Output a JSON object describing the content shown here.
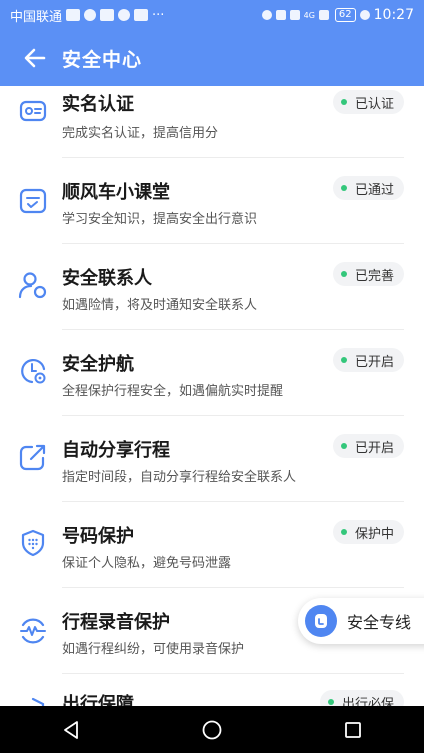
{
  "status_bar": {
    "carrier": "中国联通",
    "more": "···",
    "signal": "4G",
    "battery": "62",
    "time": "10:27"
  },
  "header": {
    "title": "安全中心"
  },
  "items": [
    {
      "title": "实名认证",
      "desc": "完成实名认证，提高信用分",
      "status": "已认证",
      "icon": "id-card-icon"
    },
    {
      "title": "顺风车小课堂",
      "desc": "学习安全知识，提高安全出行意识",
      "status": "已通过",
      "icon": "classroom-icon"
    },
    {
      "title": "安全联系人",
      "desc": "如遇险情，将及时通知安全联系人",
      "status": "已完善",
      "icon": "contact-icon"
    },
    {
      "title": "安全护航",
      "desc": "全程保护行程安全，如遇偏航实时提醒",
      "status": "已开启",
      "icon": "escort-icon"
    },
    {
      "title": "自动分享行程",
      "desc": "指定时间段，自动分享行程给安全联系人",
      "status": "已开启",
      "icon": "share-icon"
    },
    {
      "title": "号码保护",
      "desc": "保证个人隐私，避免号码泄露",
      "status": "保护中",
      "icon": "shield-icon"
    },
    {
      "title": "行程录音保护",
      "desc": "如遇行程纠纷，可使用录音保护",
      "status": "",
      "icon": "recording-icon"
    },
    {
      "title": "出行保障",
      "desc": "",
      "status": "出行必保",
      "icon": "guarantee-icon"
    }
  ],
  "float_button": {
    "label": "安全专线"
  },
  "colors": {
    "header_bg": "#5b90f5",
    "status_dot": "#34c77b",
    "icon_blue": "#4f86f1"
  }
}
